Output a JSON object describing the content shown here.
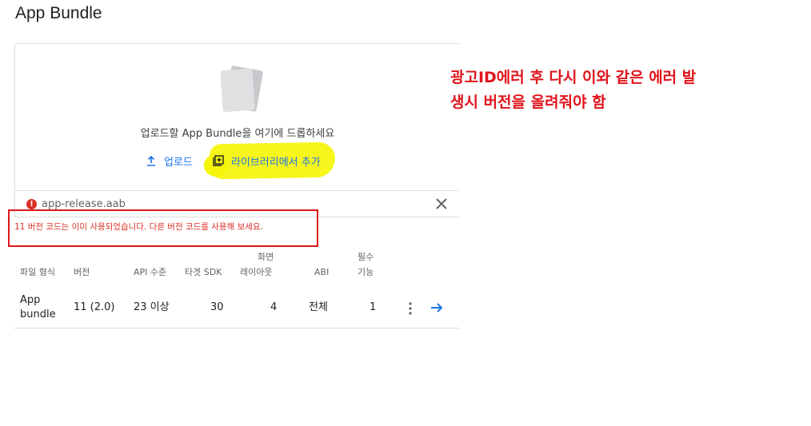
{
  "page": {
    "title": "App Bundle"
  },
  "upload": {
    "drop_text": "업로드할 App Bundle을 여기에 드롭하세요",
    "upload_label": "업로드",
    "library_label": "라이브러리에서 추가",
    "accent_color": "#1a73e8"
  },
  "file": {
    "name": "app-release.aab",
    "status_icon": "error-icon"
  },
  "error": {
    "message": "11 버전 코드는 이미 사용되었습니다. 다른 버전 코드를 사용해 보세요.",
    "color": "#d93025"
  },
  "annotation": {
    "line1": "광고ID에러 후 다시 이와 같은 에러 발",
    "line2": "생시  버전을 올려줘야 함",
    "color": "#e0141b"
  },
  "table": {
    "headers": {
      "format": "파일 형식",
      "version": "버전",
      "api": "API 수준",
      "target_sdk": "타겟 SDK",
      "layout_1": "화면",
      "layout_2": "레이아웃",
      "abi": "ABI",
      "required_1": "필수",
      "required_2": "기능"
    },
    "rows": [
      {
        "format_1": "App",
        "format_2": "bundle",
        "version": "11 (2.0)",
        "api": "23 이상",
        "target_sdk": "30",
        "layout": "4",
        "abi": "전체",
        "required": "1"
      }
    ]
  }
}
